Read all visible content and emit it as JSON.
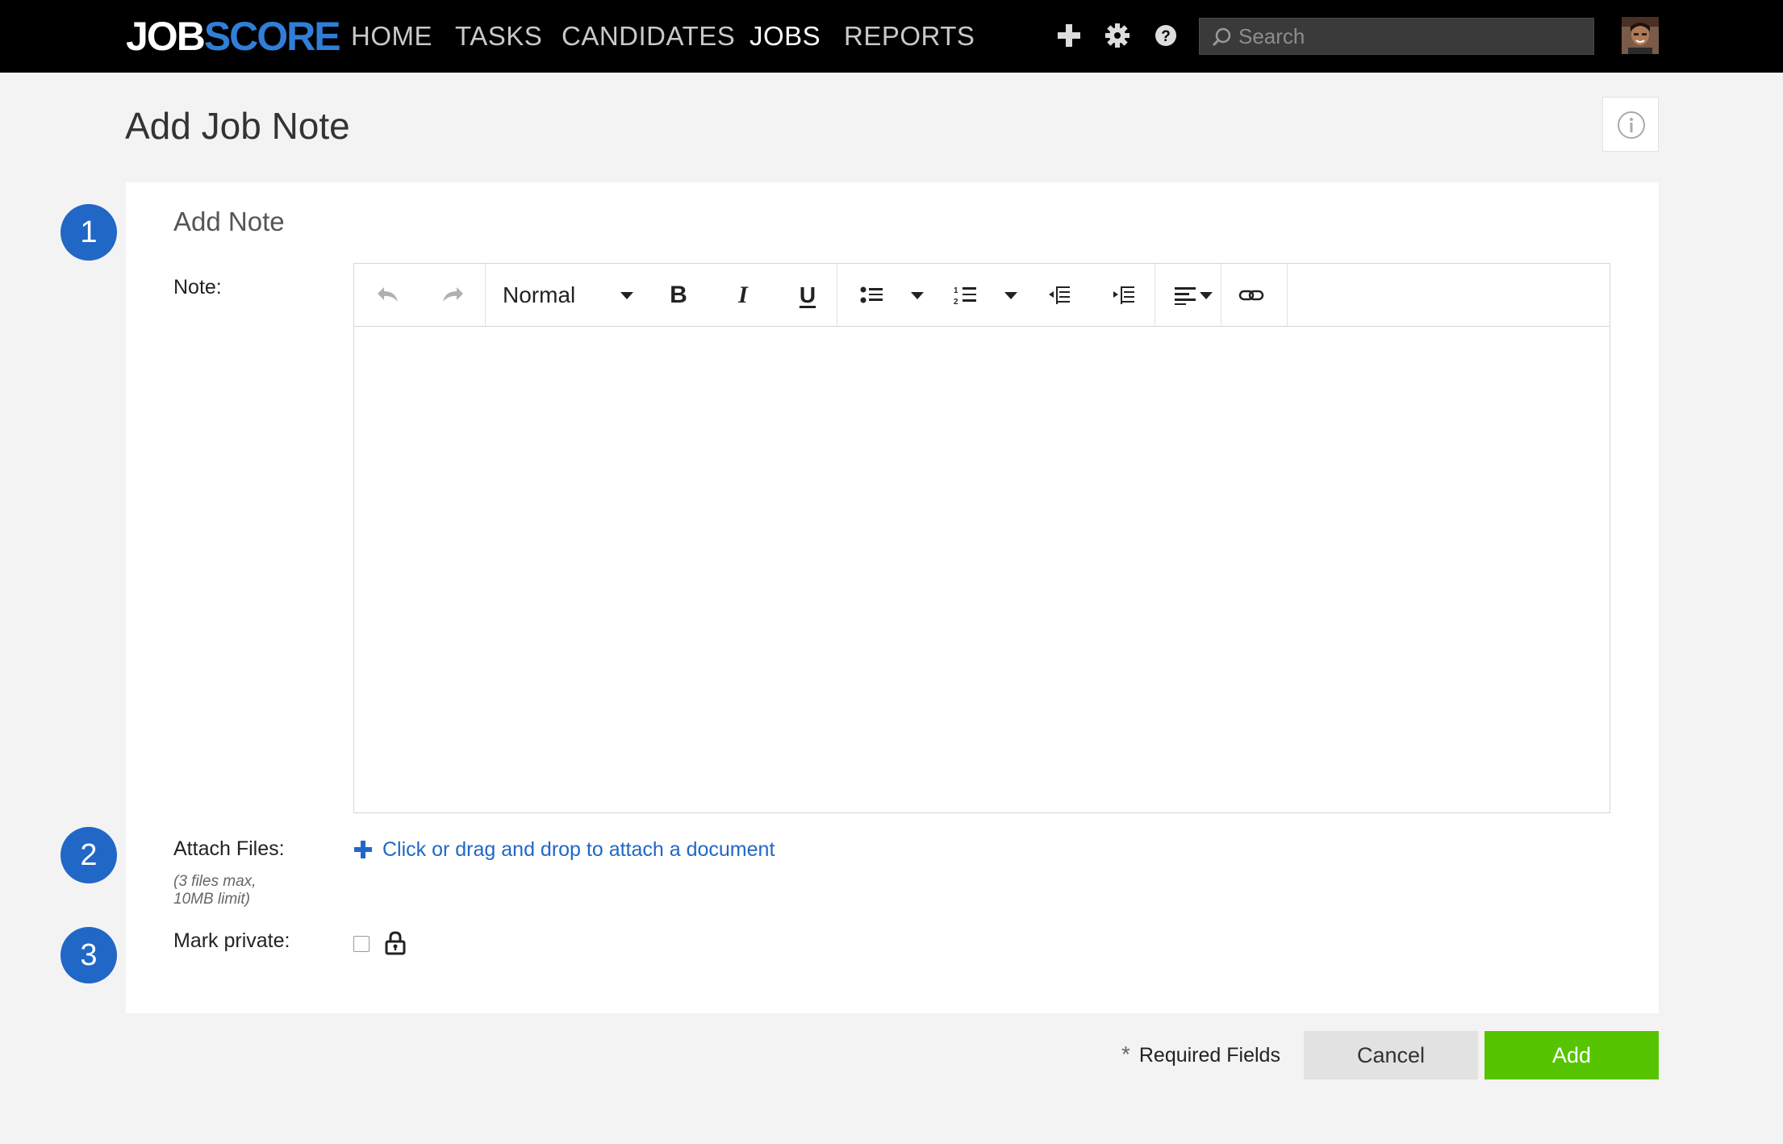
{
  "brand": {
    "part1": "JOB",
    "part2": "SCORE",
    "accent": "#2f7fd8"
  },
  "nav": {
    "items": [
      {
        "label": "HOME",
        "active": false
      },
      {
        "label": "TASKS",
        "active": false
      },
      {
        "label": "CANDIDATES",
        "active": false
      },
      {
        "label": "JOBS",
        "active": true
      },
      {
        "label": "REPORTS",
        "active": false
      }
    ],
    "icons": [
      "plus-icon",
      "gear-icon",
      "help-icon"
    ],
    "search_placeholder": "Search"
  },
  "page": {
    "title": "Add Job Note"
  },
  "form": {
    "steps": [
      "1",
      "2",
      "3"
    ],
    "section_title": "Add Note",
    "note_label": "Note:",
    "editor": {
      "format_value": "Normal",
      "bold_label": "B",
      "italic_label": "I",
      "underline_label": "U"
    },
    "attach_label": "Attach Files:",
    "attach_hint_line1": "(3 files max,",
    "attach_hint_line2": "10MB limit)",
    "attach_link": "Click or drag and drop to attach a document",
    "private_label": "Mark private:",
    "private_checked": false
  },
  "footer": {
    "required_star": "*",
    "required_text": "Required Fields",
    "cancel_label": "Cancel",
    "add_label": "Add",
    "add_color": "#56c400"
  }
}
